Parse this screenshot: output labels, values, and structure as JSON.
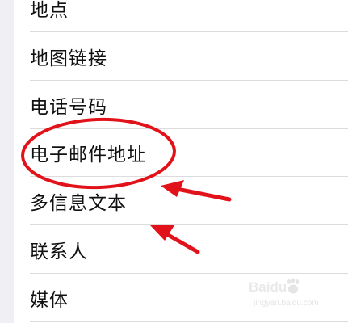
{
  "list": {
    "items": [
      {
        "label": "地点"
      },
      {
        "label": "地图链接"
      },
      {
        "label": "电话号码"
      },
      {
        "label": "电子邮件地址"
      },
      {
        "label": "多信息文本"
      },
      {
        "label": "联系人"
      },
      {
        "label": "媒体"
      }
    ]
  },
  "annotation": {
    "highlight_color": "#e2121a",
    "highlighted_item": "电子邮件地址"
  },
  "watermark": {
    "brand": "Baidu",
    "url": "jingyan.baidu.com"
  }
}
